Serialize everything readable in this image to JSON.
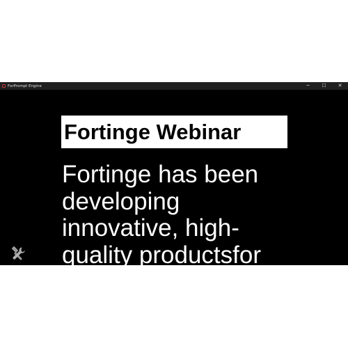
{
  "window": {
    "title": "ForPrompt Engine",
    "controls": {
      "minimize": "─",
      "maximize": "☐",
      "close": "✕"
    }
  },
  "slide": {
    "heading": "Fortinge Webinar",
    "body": "Fortinge has been developing innovative, high-quality productsfor"
  },
  "icons": {
    "app": "app-icon",
    "tools": "tools-icon"
  },
  "colors": {
    "background": "#000000",
    "text": "#ffffff",
    "heading_bg": "#ffffff",
    "heading_text": "#000000",
    "titlebar": "#202020"
  }
}
